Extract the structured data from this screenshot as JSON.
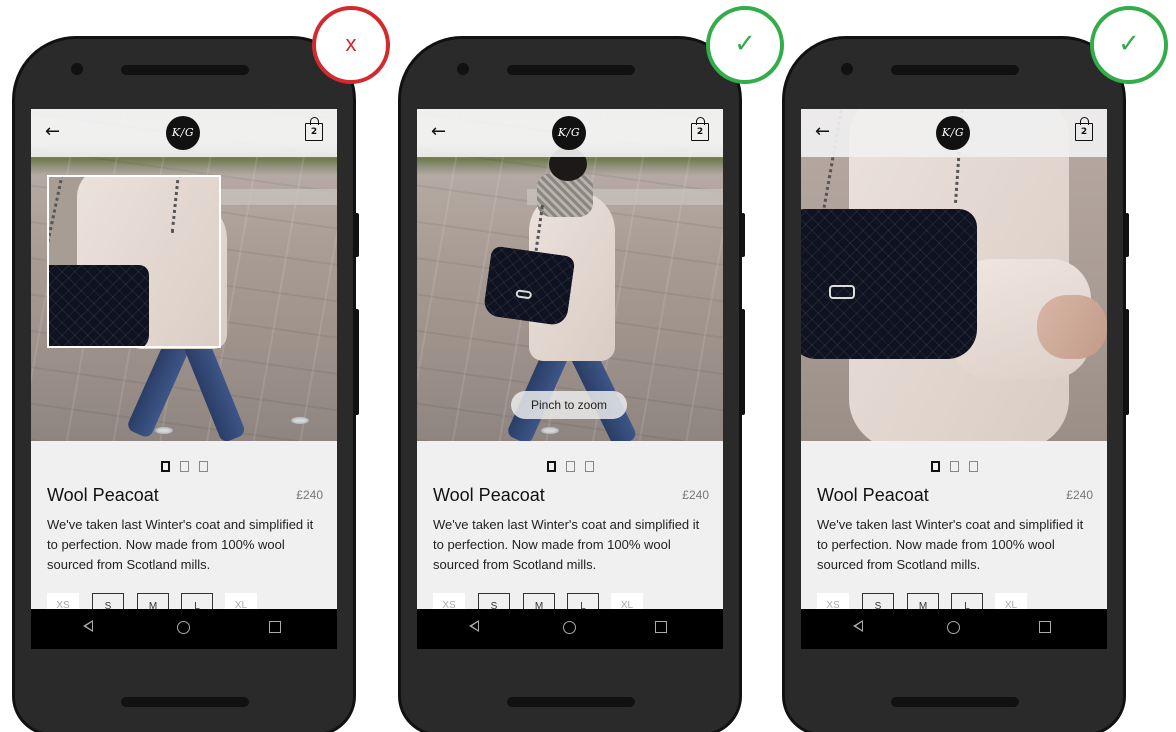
{
  "phones": [
    {
      "label": "zoom-inset-example",
      "verdict": "x",
      "status_symbol": "x",
      "logo": "K/G",
      "cart_count": "2",
      "product": {
        "title": "Wool Peacoat",
        "price": "£240",
        "description": "We've taken last Winter's coat and simplified it to perfection. Now made from 100% wool sourced from Scotland mills."
      },
      "sizes": [
        "XS",
        "S",
        "M",
        "L",
        "XL"
      ]
    },
    {
      "label": "pinch-hint-example",
      "verdict": "check",
      "status_symbol": "✓",
      "logo": "K/G",
      "cart_count": "2",
      "pinch_hint": "Pinch to zoom",
      "product": {
        "title": "Wool Peacoat",
        "price": "£240",
        "description": "We've taken last Winter's coat and simplified it to perfection. Now made from 100% wool sourced from Scotland mills."
      },
      "sizes": [
        "XS",
        "S",
        "M",
        "L",
        "XL"
      ]
    },
    {
      "label": "zoomed-image-example",
      "verdict": "check",
      "status_symbol": "✓",
      "logo": "K/G",
      "cart_count": "2",
      "product": {
        "title": "Wool Peacoat",
        "price": "£240",
        "description": "We've taken last Winter's coat and simplified it to perfection. Now made from 100% wool sourced from Scotland mills."
      },
      "sizes": [
        "XS",
        "S",
        "M",
        "L",
        "XL"
      ]
    }
  ],
  "colors": {
    "bad": "#d42a2f",
    "good": "#32ad4a",
    "phone_body": "#2a2a2a"
  },
  "icons": {
    "back": "arrow-left-icon",
    "cart": "shopping-bag-icon",
    "nav_back": "triangle-back-icon",
    "nav_home": "circle-home-icon",
    "nav_recent": "square-recents-icon"
  }
}
